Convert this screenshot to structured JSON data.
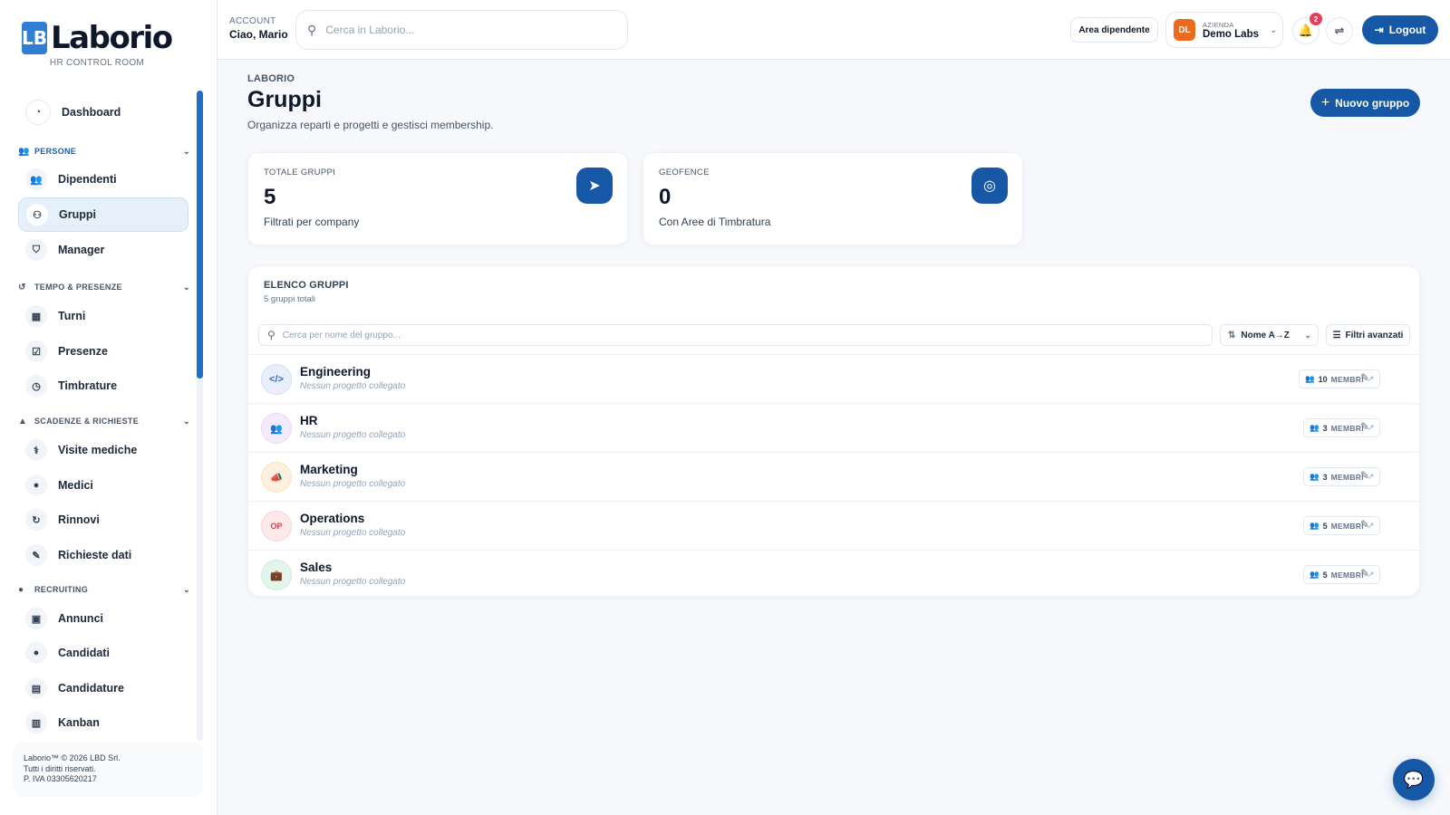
{
  "brand": {
    "mark": "LB",
    "name": "Laborio",
    "subtitle": "HR CONTROL ROOM"
  },
  "sidebar": {
    "dashboard": "Dashboard",
    "sections": [
      {
        "label": "PERSONE",
        "icon": "users-icon"
      },
      {
        "label": "TEMPO & PRESENZE",
        "icon": "history-icon"
      },
      {
        "label": "SCADENZE & RICHIESTE",
        "icon": "warning-icon"
      },
      {
        "label": "RECRUITING",
        "icon": "user-icon"
      }
    ],
    "items": [
      {
        "label": "Dipendenti",
        "icon": "users-icon"
      },
      {
        "label": "Gruppi",
        "icon": "group-icon",
        "active": true
      },
      {
        "label": "Manager",
        "icon": "shield-icon"
      },
      {
        "label": "Turni",
        "icon": "calendar-icon"
      },
      {
        "label": "Presenze",
        "icon": "calendar-check-icon"
      },
      {
        "label": "Timbrature",
        "icon": "clock-icon"
      },
      {
        "label": "Visite mediche",
        "icon": "stethoscope-icon"
      },
      {
        "label": "Medici",
        "icon": "doctor-icon"
      },
      {
        "label": "Rinnovi",
        "icon": "refresh-icon"
      },
      {
        "label": "Richieste dati",
        "icon": "user-edit-icon"
      },
      {
        "label": "Annunci",
        "icon": "briefcase-icon"
      },
      {
        "label": "Candidati",
        "icon": "user-icon"
      },
      {
        "label": "Candidature",
        "icon": "clipboard-icon"
      },
      {
        "label": "Kanban",
        "icon": "kanban-icon"
      }
    ],
    "footer": {
      "line1": "Laborio™ © 2026 LBD Srl.",
      "line2": "Tutti i diritti riservati.",
      "line3": "P. IVA 03305620217"
    }
  },
  "topbar": {
    "account_label": "ACCOUNT",
    "account_name": "Ciao, Mario",
    "search_placeholder": "Cerca in Laborio...",
    "area_button": "Area dipendente",
    "company_label": "AZIENDA",
    "company_initials": "DL",
    "company_name": "Demo Labs",
    "notifications_count": "2",
    "logout": "Logout"
  },
  "page": {
    "breadcrumb": "LABORIO",
    "title": "Gruppi",
    "subtitle": "Organizza reparti e progetti e gestisci membership.",
    "new_button": "Nuovo gruppo"
  },
  "stats": [
    {
      "label": "TOTALE GRUPPI",
      "value": "5",
      "sub": "Filtrati per company",
      "icon": "paper-plane-icon"
    },
    {
      "label": "GEOFENCE",
      "value": "0",
      "sub": "Con Aree di Timbratura",
      "icon": "location-target-icon"
    }
  ],
  "list": {
    "title": "ELENCO GRUPPI",
    "count": "5 gruppi totali",
    "search_placeholder": "Cerca per nome del gruppo...",
    "sort_label": "Nome A→Z",
    "filters_label": "Filtri avanzati",
    "members_label": "MEMBRI",
    "rows": [
      {
        "name": "Engineering",
        "sub": "Nessun progetto collegato",
        "members": "10",
        "icon": "code-icon",
        "icon_text": "</>",
        "color": "#2f6fd0",
        "bg": "#e8effb"
      },
      {
        "name": "HR",
        "sub": "Nessun progetto collegato",
        "members": "3",
        "icon": "people-icon",
        "icon_text": "👥",
        "color": "#9b4fd6",
        "bg": "#f3eafb"
      },
      {
        "name": "Marketing",
        "sub": "Nessun progetto collegato",
        "members": "3",
        "icon": "megaphone-icon",
        "icon_text": "📣",
        "color": "#e08a12",
        "bg": "#fdf1dd"
      },
      {
        "name": "Operations",
        "sub": "Nessun progetto collegato",
        "members": "5",
        "icon": "initials-icon",
        "icon_text": "OP",
        "color": "#d94050",
        "bg": "#fde8ea"
      },
      {
        "name": "Sales",
        "sub": "Nessun progetto collegato",
        "members": "5",
        "icon": "briefcase-icon",
        "icon_text": "💼",
        "color": "#1f9e64",
        "bg": "#e2f5ec"
      }
    ]
  }
}
